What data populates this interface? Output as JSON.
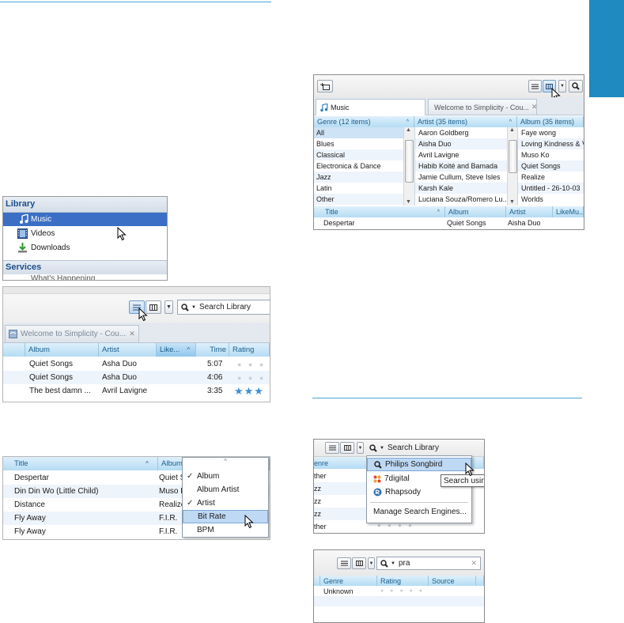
{
  "colors": {
    "accent": "#1f8ac0",
    "rule": "#4aa1d6",
    "header_blue": "#b4dcf4",
    "selection": "#3a6fc5"
  },
  "library_panel": {
    "section_library": "Library",
    "items": [
      "Music",
      "Videos",
      "Downloads"
    ],
    "section_services": "Services",
    "service_partial": "What's Happening"
  },
  "list_view": {
    "search_placeholder": "Search Library",
    "tab": "Welcome to Simplicity - Cou...",
    "headers": [
      "Album",
      "Artist",
      "Like...",
      "Time",
      "Rating"
    ],
    "rows": [
      {
        "album": "Quiet Songs",
        "artist": "Asha Duo",
        "time": "5:07",
        "rating": 0
      },
      {
        "album": "Quiet Songs",
        "artist": "Asha Duo",
        "time": "4:06",
        "rating": 0
      },
      {
        "album": "The best damn ...",
        "artist": "Avril Lavigne",
        "time": "3:35",
        "rating": 3
      }
    ]
  },
  "column_menu": {
    "headers": [
      "Title",
      "Album"
    ],
    "rows": [
      {
        "title": "Despertar",
        "album": "Quiet S"
      },
      {
        "title": "Din Din Wo (Little Child)",
        "album": "Muso K"
      },
      {
        "title": "Distance",
        "album": "Realize"
      },
      {
        "title": "Fly Away",
        "album": "F.I.R."
      },
      {
        "title": "Fly Away",
        "album": "F.I.R."
      }
    ],
    "menu_items": [
      {
        "label": "Album",
        "checked": true
      },
      {
        "label": "Album Artist",
        "checked": false
      },
      {
        "label": "Artist",
        "checked": true
      },
      {
        "label": "Bit Rate",
        "checked": false
      },
      {
        "label": "BPM",
        "checked": false
      }
    ]
  },
  "filter_view": {
    "tab_music": "Music",
    "tab_other": "Welcome to Simplicity - Cou...",
    "genre_header": "Genre (12 items)",
    "artist_header": "Artist (35 items)",
    "album_header": "Album (35 items)",
    "genres": [
      "All",
      "Blues",
      "Classical",
      "Electronica & Dance",
      "Jazz",
      "Latin",
      "Other"
    ],
    "artists": [
      "Aaron Goldberg",
      "Aisha Duo",
      "Avril Lavigne",
      "Habib Koité and Bamada",
      "Jamie Cullum, Steve Isles",
      "Karsh Kale",
      "Luciana Souza/Romero Lu..."
    ],
    "albums": [
      "Faye wong",
      "Loving Kindness & V",
      "Muso Ko",
      "Quiet Songs",
      "Realize",
      "Untitled - 26-10-03",
      "Worlds"
    ],
    "track_headers": [
      "Title",
      "Album",
      "Artist",
      "LikeMu..."
    ],
    "track_row": {
      "title": "Despertar",
      "album": "Quiet Songs",
      "artist": "Aisha Duo"
    }
  },
  "search_engines": {
    "search_label": "Search Library",
    "partial_header": "enre",
    "partial_rows": [
      "ther",
      "zz",
      "zz",
      "zz",
      "ther"
    ],
    "menu_items": [
      "Philips Songbird",
      "7digital",
      "Rhapsody"
    ],
    "manage": "Manage Search Engines...",
    "tooltip": "Search usin"
  },
  "search_result": {
    "query": "pra",
    "headers": [
      "Genre",
      "Rating",
      "Source"
    ],
    "row_genre": "Unknown"
  }
}
